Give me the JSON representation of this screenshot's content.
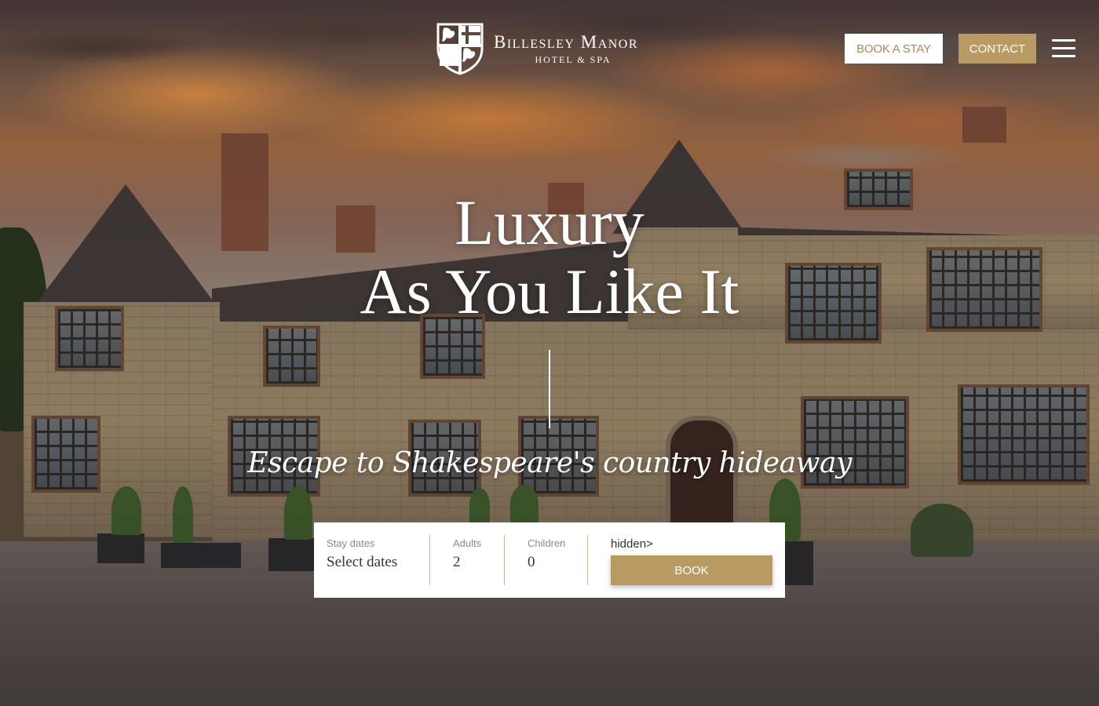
{
  "brand": {
    "name": "Billesley Manor",
    "subtitle": "HOTEL & SPA"
  },
  "header": {
    "book_stay_label": "BOOK A STAY",
    "contact_label": "CONTACT"
  },
  "hero": {
    "headline_line1": "Luxury",
    "headline_line2": "As You Like It",
    "tagline": "Escape to Shakespeare's country hideaway"
  },
  "booking": {
    "stay_dates_label": "Stay dates",
    "stay_dates_value": "Select dates",
    "adults_label": "Adults",
    "adults_value": "2",
    "children_label": "Children",
    "children_value": "0",
    "hidden_text": "hidden>",
    "book_label": "BOOK"
  },
  "colors": {
    "accent_gold": "#b89a62",
    "white": "#ffffff"
  }
}
